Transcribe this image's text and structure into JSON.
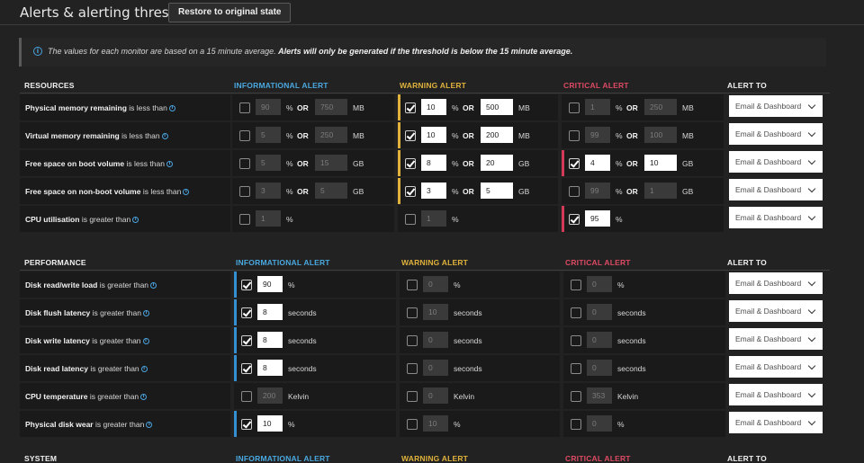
{
  "header": {
    "title": "Alerts & alerting thresholds",
    "restore_label": "Restore to original state"
  },
  "notice": {
    "icon": "info-icon",
    "text_plain": "The values for each monitor are based on a 15 minute average.",
    "text_bold": "Alerts will only be generated if the threshold is below the 15 minute average."
  },
  "colors": {
    "informational": "#4aa8e0",
    "warning": "#e0b23c",
    "critical": "#dd4a63"
  },
  "columns": {
    "informational": "INFORMATIONAL ALERT",
    "warning": "WARNING ALERT",
    "critical": "CRITICAL ALERT",
    "alert_to": "ALERT TO"
  },
  "sections": [
    {
      "title": "RESOURCES",
      "rows": [
        {
          "name": "Physical memory remaining",
          "cond": "is less than",
          "info": {
            "checked": false,
            "v1": "90",
            "u1": "%",
            "or": "OR",
            "v2": "750",
            "u2": "MB"
          },
          "warn": {
            "checked": true,
            "v1": "10",
            "u1": "%",
            "or": "OR",
            "v2": "500",
            "u2": "MB"
          },
          "crit": {
            "checked": false,
            "v1": "1",
            "u1": "%",
            "or": "OR",
            "v2": "250",
            "u2": "MB"
          },
          "alert_to": "Email & Dashboard"
        },
        {
          "name": "Virtual memory remaining",
          "cond": "is less than",
          "info": {
            "checked": false,
            "v1": "5",
            "u1": "%",
            "or": "OR",
            "v2": "250",
            "u2": "MB"
          },
          "warn": {
            "checked": true,
            "v1": "10",
            "u1": "%",
            "or": "OR",
            "v2": "200",
            "u2": "MB"
          },
          "crit": {
            "checked": false,
            "v1": "99",
            "u1": "%",
            "or": "OR",
            "v2": "100",
            "u2": "MB"
          },
          "alert_to": "Email & Dashboard"
        },
        {
          "name": "Free space on boot volume",
          "cond": "is less than",
          "info": {
            "checked": false,
            "v1": "5",
            "u1": "%",
            "or": "OR",
            "v2": "15",
            "u2": "GB"
          },
          "warn": {
            "checked": true,
            "v1": "8",
            "u1": "%",
            "or": "OR",
            "v2": "20",
            "u2": "GB"
          },
          "crit": {
            "checked": true,
            "v1": "4",
            "u1": "%",
            "or": "OR",
            "v2": "10",
            "u2": "GB"
          },
          "alert_to": "Email & Dashboard"
        },
        {
          "name": "Free space on non-boot volume",
          "cond": "is less than",
          "info": {
            "checked": false,
            "v1": "3",
            "u1": "%",
            "or": "OR",
            "v2": "5",
            "u2": "GB"
          },
          "warn": {
            "checked": true,
            "v1": "3",
            "u1": "%",
            "or": "OR",
            "v2": "5",
            "u2": "GB"
          },
          "crit": {
            "checked": false,
            "v1": "99",
            "u1": "%",
            "or": "OR",
            "v2": "1",
            "u2": "GB"
          },
          "alert_to": "Email & Dashboard"
        },
        {
          "name": "CPU utilisation",
          "cond": "is greater than",
          "info": {
            "checked": false,
            "v1": "1",
            "u1": "%"
          },
          "warn": {
            "checked": false,
            "v1": "1",
            "u1": "%"
          },
          "crit": {
            "checked": true,
            "v1": "95",
            "u1": "%"
          },
          "alert_to": "Email & Dashboard"
        }
      ]
    },
    {
      "title": "PERFORMANCE",
      "rows": [
        {
          "name": "Disk read/write load",
          "cond": "is greater than",
          "info": {
            "checked": true,
            "v1": "90",
            "u1": "%"
          },
          "warn": {
            "checked": false,
            "v1": "0",
            "u1": "%"
          },
          "crit": {
            "checked": false,
            "v1": "0",
            "u1": "%"
          },
          "alert_to": "Email & Dashboard"
        },
        {
          "name": "Disk flush latency",
          "cond": "is greater than",
          "info": {
            "checked": true,
            "v1": "8",
            "u1": "seconds"
          },
          "warn": {
            "checked": false,
            "v1": "10",
            "u1": "seconds"
          },
          "crit": {
            "checked": false,
            "v1": "0",
            "u1": "seconds"
          },
          "alert_to": "Email & Dashboard"
        },
        {
          "name": "Disk write latency",
          "cond": "is greater than",
          "info": {
            "checked": true,
            "v1": "8",
            "u1": "seconds"
          },
          "warn": {
            "checked": false,
            "v1": "0",
            "u1": "seconds"
          },
          "crit": {
            "checked": false,
            "v1": "0",
            "u1": "seconds"
          },
          "alert_to": "Email & Dashboard"
        },
        {
          "name": "Disk read latency",
          "cond": "is greater than",
          "info": {
            "checked": true,
            "v1": "8",
            "u1": "seconds"
          },
          "warn": {
            "checked": false,
            "v1": "0",
            "u1": "seconds"
          },
          "crit": {
            "checked": false,
            "v1": "0",
            "u1": "seconds"
          },
          "alert_to": "Email & Dashboard"
        },
        {
          "name": "CPU temperature",
          "cond": "is greater than",
          "info": {
            "checked": false,
            "v1": "200",
            "u1": "Kelvin"
          },
          "warn": {
            "checked": false,
            "v1": "0",
            "u1": "Kelvin"
          },
          "crit": {
            "checked": false,
            "v1": "353",
            "u1": "Kelvin"
          },
          "alert_to": "Email & Dashboard"
        },
        {
          "name": "Physical disk wear",
          "cond": "is greater than",
          "info": {
            "checked": true,
            "v1": "10",
            "u1": "%"
          },
          "warn": {
            "checked": false,
            "v1": "10",
            "u1": "%"
          },
          "crit": {
            "checked": false,
            "v1": "0",
            "u1": "%"
          },
          "alert_to": "Email & Dashboard"
        }
      ]
    },
    {
      "title": "SYSTEM",
      "rows": []
    }
  ]
}
